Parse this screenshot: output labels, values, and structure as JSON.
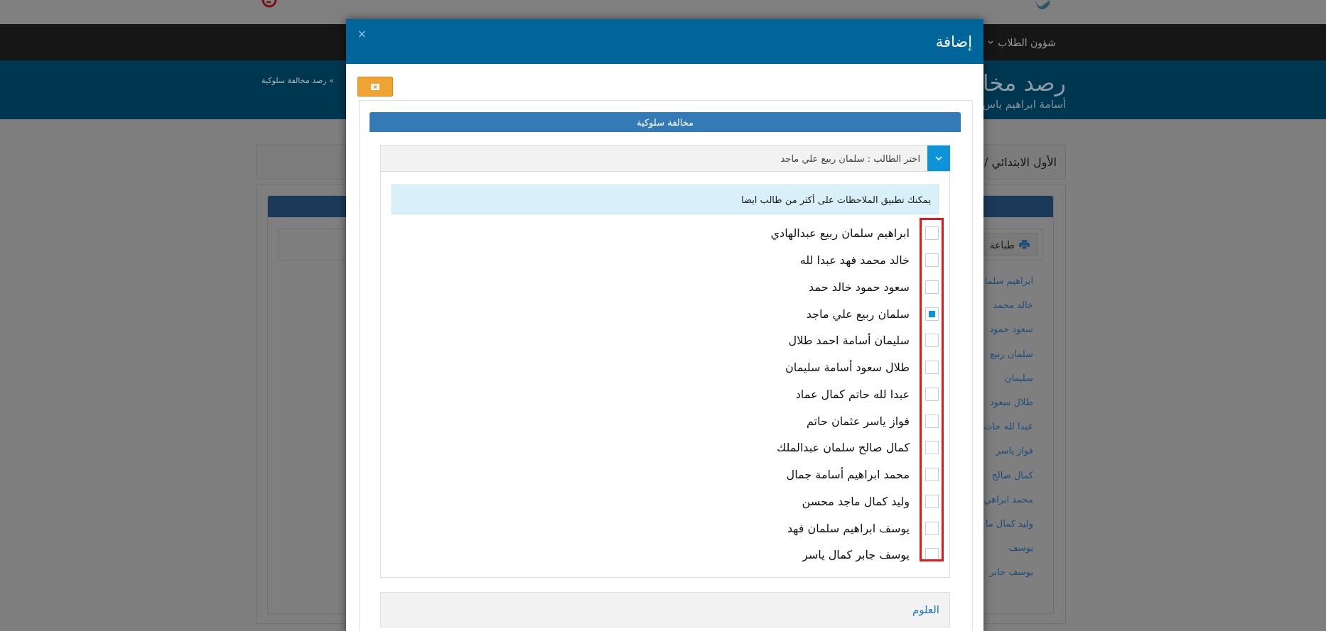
{
  "nav": [
    {
      "label": "شؤون الطلاب"
    }
  ],
  "page_title": "رصد مخا",
  "page_subtitle": "أسامة ابراهيم ياس",
  "breadcrumb": "» رصد مخالفة سلوكية",
  "class_label": "الأول الابتدائي /",
  "print_button": "طباعة",
  "background_students": [
    "ابراهيم سلما",
    "خالد محمد",
    "سعود حمود",
    "سلمان ربيع",
    "سليمان",
    "طلال سعود",
    "عبدا لله حات",
    "فواز ياسر",
    "كمال صالح",
    "محمد ابراهي",
    "وليد كمال ما",
    "يوسف",
    "يوسف جابر"
  ],
  "modal": {
    "title": "إضافة",
    "close": "×",
    "panel_title": "مخالفة سلوكية",
    "accordion": [
      {
        "label": "اختر الطالب : سلمان ربيع علي ماجد",
        "expanded": true,
        "alert": "يمكنك تطبيق الملاحظات على أكثر من طالب ايضا",
        "students": [
          {
            "name": "ابراهيم سلمان ربيع عبدالهادي",
            "checked": false
          },
          {
            "name": "خالد محمد فهد عبدا لله",
            "checked": false
          },
          {
            "name": "سعود حمود خالد حمد",
            "checked": false
          },
          {
            "name": "سلمان ربيع علي ماجد",
            "checked": true
          },
          {
            "name": "سليمان أسامة احمد طلال",
            "checked": false
          },
          {
            "name": "طلال سعود أسامة سليمان",
            "checked": false
          },
          {
            "name": "عبدا لله حاتم كمال عماد",
            "checked": false
          },
          {
            "name": "فواز ياسر عثمان حاتم",
            "checked": false
          },
          {
            "name": "كمال صالح سلمان عبدالملك",
            "checked": false
          },
          {
            "name": "محمد ابراهيم أسامة جمال",
            "checked": false
          },
          {
            "name": "وليد كمال ماجد محسن",
            "checked": false
          },
          {
            "name": "يوسف ابراهيم سلمان فهد",
            "checked": false
          },
          {
            "name": "يوسف جابر كمال ياسر",
            "checked": false
          }
        ]
      },
      {
        "label": "العلوم",
        "expanded": false
      }
    ]
  }
}
